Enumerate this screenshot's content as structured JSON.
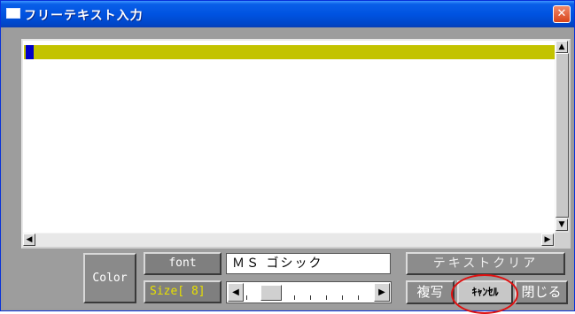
{
  "window": {
    "title": "フリーテキスト入力",
    "close_glyph": "✕",
    "frame_color": "#0054e3"
  },
  "editor": {
    "text": "",
    "highlight_color": "#c3c300",
    "caret_color": "#0000c8",
    "scroll_up": "▲",
    "scroll_down": "▼",
    "scroll_left": "◀",
    "scroll_right": "▶"
  },
  "controls": {
    "color_label": "Color",
    "font_label": "font",
    "font_value": "ＭＳ ゴシック",
    "size_label": "Size[ 8]",
    "size_value": 8,
    "slider_left": "◀",
    "slider_right": "▶",
    "clear_label": "テキストクリア",
    "copy_label": "複写",
    "cancel_label": "ｷｬﾝｾﾙ",
    "close_label": "閉じる"
  },
  "annotation": {
    "ring_color": "#e01010"
  }
}
